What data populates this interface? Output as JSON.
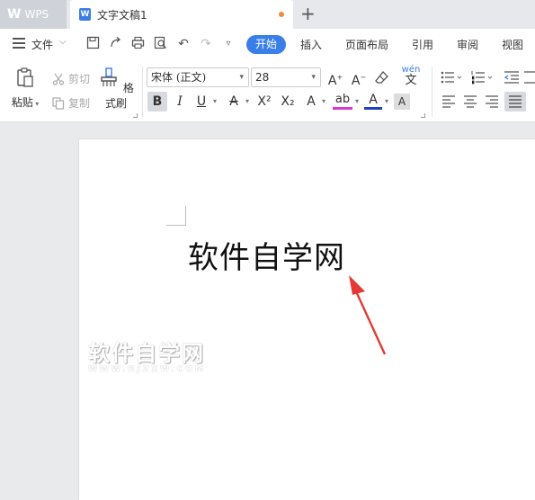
{
  "window": {
    "app_tab": "WPS",
    "doc_tab": "文字文稿1",
    "new_tab_symbol": "+"
  },
  "menu": {
    "file": "文件",
    "tabs": [
      "开始",
      "插入",
      "页面布局",
      "引用",
      "审阅",
      "视图"
    ],
    "active_tab": "开始"
  },
  "toolbar": {
    "paste": "粘贴",
    "cut": "剪切",
    "copy": "复制",
    "format_painter": "格式刷",
    "font_name": "宋体 (正文)",
    "font_size": "28",
    "phonetic": "wén",
    "bold": "B",
    "italic": "I",
    "underline": "U",
    "strike": "A",
    "superscript": "X²",
    "subscript": "X₂",
    "text_effect": "A",
    "highlight": "ab",
    "font_color": "A",
    "char_shading": "A"
  },
  "colors": {
    "accent": "#3a7ee8",
    "highlight": "#d63ad6",
    "font_color": "#1f3fbf",
    "arrow": "#e53935"
  },
  "document": {
    "text": "软件自学网"
  },
  "watermark": {
    "main": "软件自学网",
    "sub": "WWW.RJZXW.COM"
  }
}
